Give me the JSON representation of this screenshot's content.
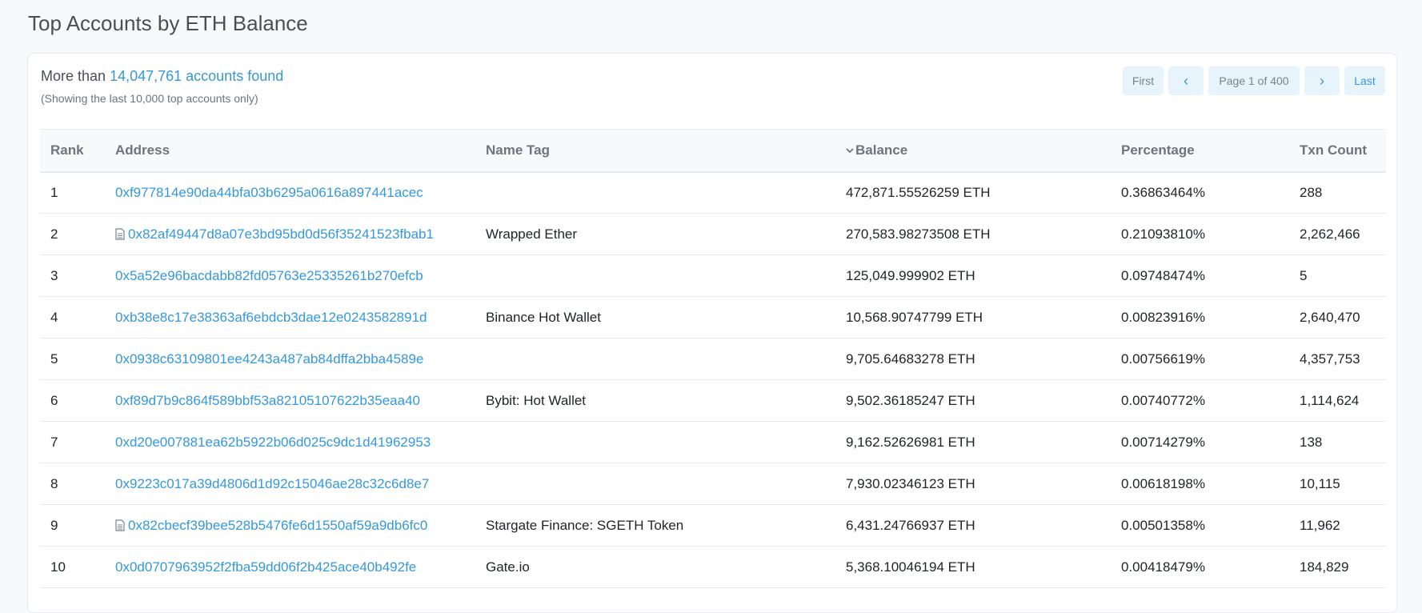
{
  "title": "Top Accounts by ETH Balance",
  "summary": {
    "prefix": "More than",
    "link_text": "14,047,761 accounts found",
    "note": "(Showing the last 10,000 top accounts only)"
  },
  "pagination": {
    "first": "First",
    "prev": "‹",
    "info": "Page 1 of 400",
    "next": "›",
    "last": "Last"
  },
  "table": {
    "headers": {
      "rank": "Rank",
      "address": "Address",
      "name_tag": "Name Tag",
      "balance": "Balance",
      "percentage": "Percentage",
      "txn_count": "Txn Count"
    },
    "rows": [
      {
        "rank": "1",
        "address": "0xf977814e90da44bfa03b6295a0616a897441acec",
        "is_contract": false,
        "name_tag": "",
        "balance": "472,871.55526259 ETH",
        "percentage": "0.36863464%",
        "txn_count": "288"
      },
      {
        "rank": "2",
        "address": "0x82af49447d8a07e3bd95bd0d56f35241523fbab1",
        "is_contract": true,
        "name_tag": "Wrapped Ether",
        "balance": "270,583.98273508 ETH",
        "percentage": "0.21093810%",
        "txn_count": "2,262,466"
      },
      {
        "rank": "3",
        "address": "0x5a52e96bacdabb82fd05763e25335261b270efcb",
        "is_contract": false,
        "name_tag": "",
        "balance": "125,049.999902 ETH",
        "percentage": "0.09748474%",
        "txn_count": "5"
      },
      {
        "rank": "4",
        "address": "0xb38e8c17e38363af6ebdcb3dae12e0243582891d",
        "is_contract": false,
        "name_tag": "Binance Hot Wallet",
        "balance": "10,568.90747799 ETH",
        "percentage": "0.00823916%",
        "txn_count": "2,640,470"
      },
      {
        "rank": "5",
        "address": "0x0938c63109801ee4243a487ab84dffa2bba4589e",
        "is_contract": false,
        "name_tag": "",
        "balance": "9,705.64683278 ETH",
        "percentage": "0.00756619%",
        "txn_count": "4,357,753"
      },
      {
        "rank": "6",
        "address": "0xf89d7b9c864f589bbf53a82105107622b35eaa40",
        "is_contract": false,
        "name_tag": "Bybit: Hot Wallet",
        "balance": "9,502.36185247 ETH",
        "percentage": "0.00740772%",
        "txn_count": "1,114,624"
      },
      {
        "rank": "7",
        "address": "0xd20e007881ea62b5922b06d025c9dc1d41962953",
        "is_contract": false,
        "name_tag": "",
        "balance": "9,162.52626981 ETH",
        "percentage": "0.00714279%",
        "txn_count": "138"
      },
      {
        "rank": "8",
        "address": "0x9223c017a39d4806d1d92c15046ae28c32c6d8e7",
        "is_contract": false,
        "name_tag": "",
        "balance": "7,930.02346123 ETH",
        "percentage": "0.00618198%",
        "txn_count": "10,115"
      },
      {
        "rank": "9",
        "address": "0x82cbecf39bee528b5476fe6d1550af59a9db6fc0",
        "is_contract": true,
        "name_tag": "Stargate Finance: SGETH Token",
        "balance": "6,431.24766937 ETH",
        "percentage": "0.00501358%",
        "txn_count": "11,962"
      },
      {
        "rank": "10",
        "address": "0x0d0707963952f2fba59dd06f2b425ace40b492fe",
        "is_contract": false,
        "name_tag": "Gate.io",
        "balance": "5,368.10046194 ETH",
        "percentage": "0.00418479%",
        "txn_count": "184,829"
      }
    ]
  },
  "colors": {
    "link": "#3498db",
    "text": "#212529",
    "muted": "#6c757d",
    "border": "#e7eaf3",
    "pager_bg": "#e8f4fb"
  },
  "icons": {
    "contract": "doc-icon",
    "sort": "chevron-down-icon"
  }
}
